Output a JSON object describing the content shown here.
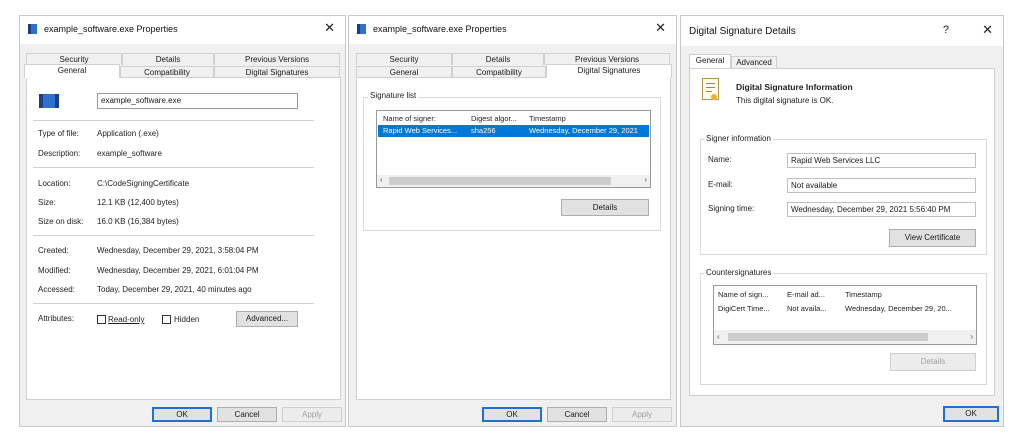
{
  "win1": {
    "title": "example_software.exe Properties",
    "tabs_row1": [
      "Security",
      "Details",
      "Previous Versions"
    ],
    "tabs_row2": [
      "General",
      "Compatibility",
      "Digital Signatures"
    ],
    "filename": "example_software.exe",
    "type_label": "Type of file:",
    "type_value": "Application (.exe)",
    "desc_label": "Description:",
    "desc_value": "example_software",
    "location_label": "Location:",
    "location_value": "C:\\CodeSigningCertificate",
    "size_label": "Size:",
    "size_value": "12.1 KB (12,400 bytes)",
    "sizedisk_label": "Size on disk:",
    "sizedisk_value": "16.0 KB (16,384 bytes)",
    "created_label": "Created:",
    "created_value": "Wednesday, December 29, 2021, 3:58:04 PM",
    "modified_label": "Modified:",
    "modified_value": "Wednesday, December 29, 2021, 6:01:04 PM",
    "accessed_label": "Accessed:",
    "accessed_value": "Today, December 29, 2021, 40 minutes ago",
    "attributes_label": "Attributes:",
    "readonly": "Read-only",
    "hidden": "Hidden",
    "advanced": "Advanced...",
    "ok": "OK",
    "cancel": "Cancel",
    "apply": "Apply"
  },
  "win2": {
    "title": "example_software.exe Properties",
    "tabs_row1": [
      "Security",
      "Details",
      "Previous Versions"
    ],
    "tabs_row2": [
      "General",
      "Compatibility",
      "Digital Signatures"
    ],
    "siglist_label": "Signature list",
    "columns": [
      "Name of signer:",
      "Digest algor...",
      "Timestamp"
    ],
    "row": [
      "Rapid Web Services...",
      "sha256",
      "Wednesday, December 29, 2021"
    ],
    "details": "Details",
    "ok": "OK",
    "cancel": "Cancel",
    "apply": "Apply"
  },
  "win3": {
    "title": "Digital Signature Details",
    "help": "?",
    "tabs": [
      "General",
      "Advanced"
    ],
    "info_title": "Digital Signature Information",
    "info_sub": "This digital signature is OK.",
    "signer_group": "Signer information",
    "name_label": "Name:",
    "name_value": "Rapid Web Services LLC",
    "email_label": "E-mail:",
    "email_value": "Not available",
    "time_label": "Signing time:",
    "time_value": "Wednesday, December 29, 2021 5:56:40 PM",
    "view_cert": "View Certificate",
    "counter_group": "Countersignatures",
    "columns": [
      "Name of sign...",
      "E-mail ad...",
      "Timestamp"
    ],
    "row": [
      "DigiCert Time...",
      "Not availa...",
      "Wednesday, December 29, 20..."
    ],
    "details": "Details",
    "ok": "OK"
  },
  "colors": {
    "selection": "#0078d7",
    "default_button_border": "#1c70d8"
  },
  "icons": [
    "app-icon",
    "close-icon",
    "help-icon",
    "certificate-icon",
    "scroll-left-icon",
    "scroll-right-icon"
  ]
}
